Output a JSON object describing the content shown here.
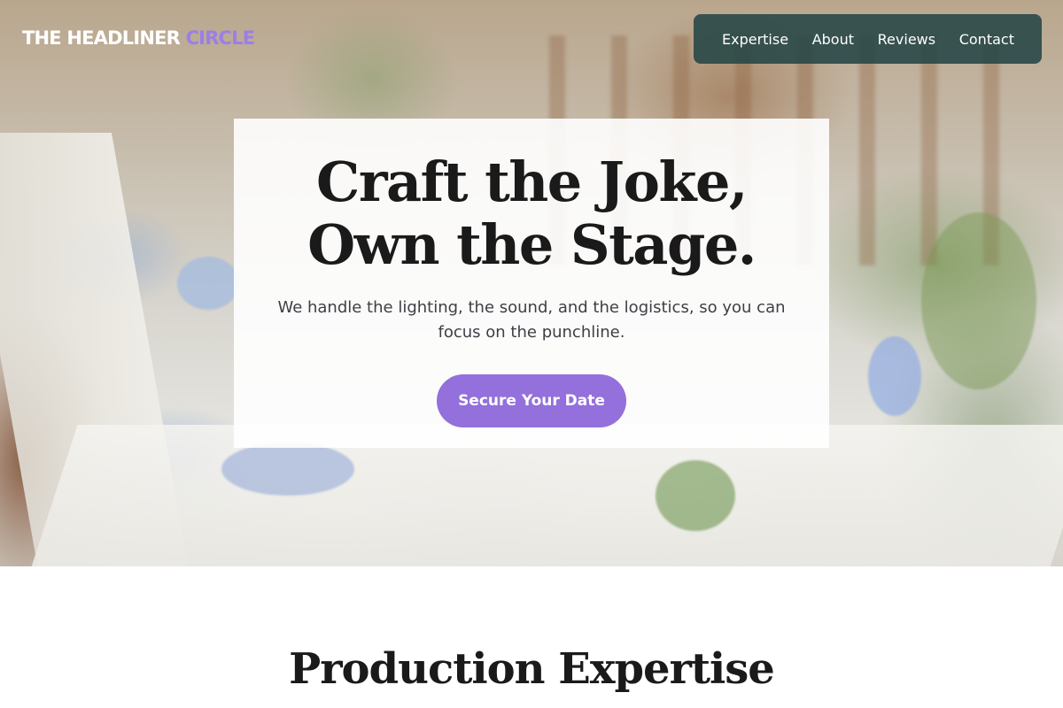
{
  "brand": {
    "name_primary": "THE HEADLINER",
    "name_accent": "CIRCLE",
    "accent_color": "#9b7fe6"
  },
  "nav": {
    "items": [
      {
        "label": "Expertise"
      },
      {
        "label": "About"
      },
      {
        "label": "Reviews"
      },
      {
        "label": "Contact"
      }
    ],
    "background": "#244646"
  },
  "hero": {
    "title_line1": "Craft the Joke,",
    "title_line2": "Own the Stage.",
    "subtitle": "We handle the lighting, the sound, and the logistics, so you can focus on the punchline.",
    "cta_label": "Secure Your Date",
    "cta_color": "#9370db",
    "background_image": "banquet-table-photo"
  },
  "sections": {
    "expertise_title": "Production Expertise"
  }
}
